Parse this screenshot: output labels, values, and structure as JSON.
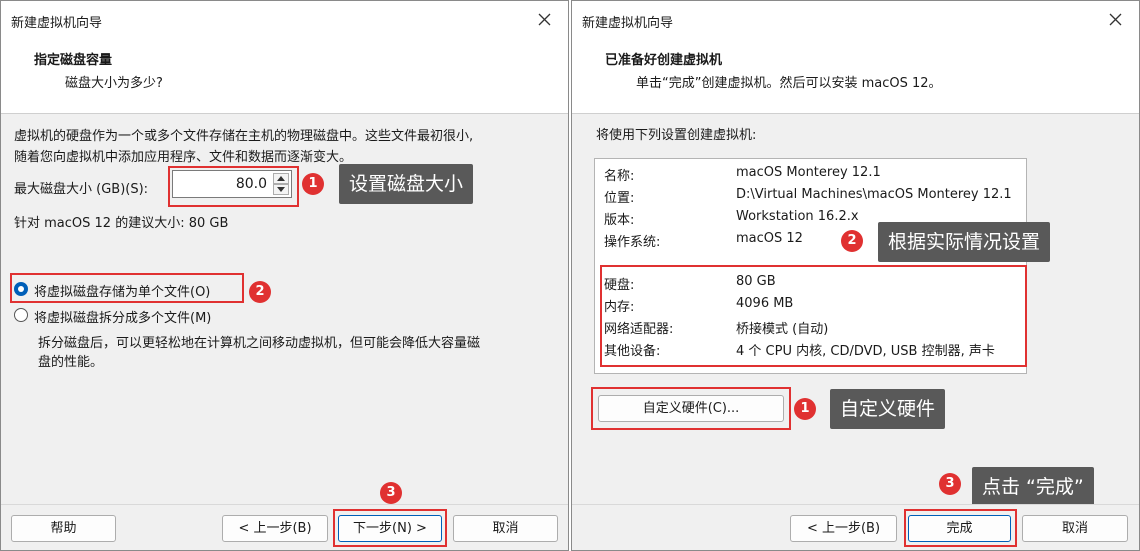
{
  "left": {
    "window_title": "新建虚拟机向导",
    "header_title": "指定磁盘容量",
    "header_subtitle": "磁盘大小为多少?",
    "desc_line1": "虚拟机的硬盘作为一个或多个文件存储在主机的物理磁盘中。这些文件最初很小,",
    "desc_line2": "随着您向虚拟机中添加应用程序、文件和数据而逐渐变大。",
    "max_size_label": "最大磁盘大小 (GB)(S):",
    "max_size_value": "80.0",
    "recommend": "针对 macOS 12 的建议大小: 80 GB",
    "radio_single": "将虚拟磁盘存储为单个文件(O)",
    "radio_multi": "将虚拟磁盘拆分成多个文件(M)",
    "split_desc1": "拆分磁盘后，可以更轻松地在计算机之间移动虚拟机，但可能会降低大容量磁",
    "split_desc2": "盘的性能。",
    "btn_help": "帮助",
    "btn_back": "< 上一步(B)",
    "btn_next": "下一步(N) >",
    "btn_cancel": "取消",
    "callout_1": "设置磁盘大小",
    "badge_1": "1",
    "badge_2": "2",
    "badge_3": "3"
  },
  "right": {
    "window_title": "新建虚拟机向导",
    "header_title": "已准备好创建虚拟机",
    "header_subtitle": "单击“完成”创建虚拟机。然后可以安装 macOS 12。",
    "intro": "将使用下列设置创建虚拟机:",
    "settings": [
      {
        "label": "名称:",
        "value": "macOS Monterey 12.1"
      },
      {
        "label": "位置:",
        "value": "D:\\Virtual Machines\\macOS Monterey 12.1"
      },
      {
        "label": "版本:",
        "value": "Workstation 16.2.x"
      },
      {
        "label": "操作系统:",
        "value": "macOS 12"
      },
      {
        "label": "硬盘:",
        "value": "80 GB"
      },
      {
        "label": "内存:",
        "value": "4096 MB"
      },
      {
        "label": "网络适配器:",
        "value": "桥接模式 (自动)"
      },
      {
        "label": "其他设备:",
        "value": "4 个 CPU 内核, CD/DVD, USB 控制器, 声卡"
      }
    ],
    "btn_customize": "自定义硬件(C)...",
    "btn_back": "< 上一步(B)",
    "btn_finish": "完成",
    "btn_cancel": "取消",
    "callout_1": "自定义硬件",
    "callout_2": "根据实际情况设置",
    "callout_3": "点击 “完成”",
    "badge_1": "1",
    "badge_2": "2",
    "badge_3": "3"
  },
  "colors": {
    "accent": "#005fb8",
    "annotation_red": "#e03131",
    "callout_bg": "#595959"
  },
  "icons": [
    "close-icon",
    "spin-up-icon",
    "spin-down-icon"
  ]
}
